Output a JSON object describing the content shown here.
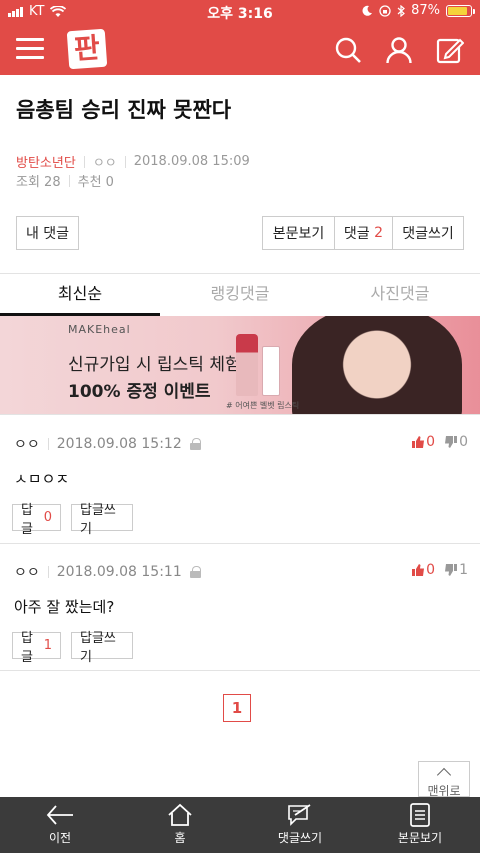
{
  "status_bar": {
    "carrier": "KT",
    "time": "오후 3:16",
    "battery": "87%",
    "battery_level": 0.87
  },
  "header": {
    "logo_text": "판",
    "icons": [
      "menu-icon",
      "search-icon",
      "user-icon",
      "edit-icon"
    ]
  },
  "post": {
    "title": "음총팀 승리 진짜 못짠다",
    "author": "방탄소년단",
    "nickname": "ㅇㅇ",
    "datetime": "2018.09.08 15:09",
    "views": "조회 28",
    "recommend": "추천 0"
  },
  "buttons": {
    "my_comments": "내 댓글",
    "view_post": "본문보기",
    "comments_label": "댓글",
    "comments_count": "2",
    "write_comment": "댓글쓰기"
  },
  "tabs": [
    {
      "label": "최신순",
      "active": true
    },
    {
      "label": "랭킹댓글",
      "active": false
    },
    {
      "label": "사진댓글",
      "active": false
    }
  ],
  "banner": {
    "brand": "MAKEheal",
    "line1": "신규가입 시 립스틱 체험분",
    "line2": "100% 증정 이벤트",
    "caption": "# 어여쁜 벨벳 립스틱"
  },
  "comments": [
    {
      "nick": "ㅇㅇ",
      "datetime": "2018.09.08 15:12",
      "body": "ㅅㅁㅇㅈ",
      "up": "0",
      "down": "0",
      "reply_label": "답글",
      "reply_count": "0",
      "write_reply": "답글쓰기"
    },
    {
      "nick": "ㅇㅇ",
      "datetime": "2018.09.08 15:11",
      "body": "아주 잘 짰는데?",
      "up": "0",
      "down": "1",
      "reply_label": "답글",
      "reply_count": "1",
      "write_reply": "답글쓰기"
    }
  ],
  "pagination": {
    "current": "1"
  },
  "to_top": "맨위로",
  "bottom_nav": [
    {
      "label": "이전",
      "icon": "back-arrow-icon"
    },
    {
      "label": "홈",
      "icon": "home-icon"
    },
    {
      "label": "댓글쓰기",
      "icon": "comment-write-icon"
    },
    {
      "label": "본문보기",
      "icon": "document-icon"
    }
  ],
  "colors": {
    "accent": "#e14b47",
    "nav_bg": "#3b3b3b"
  }
}
